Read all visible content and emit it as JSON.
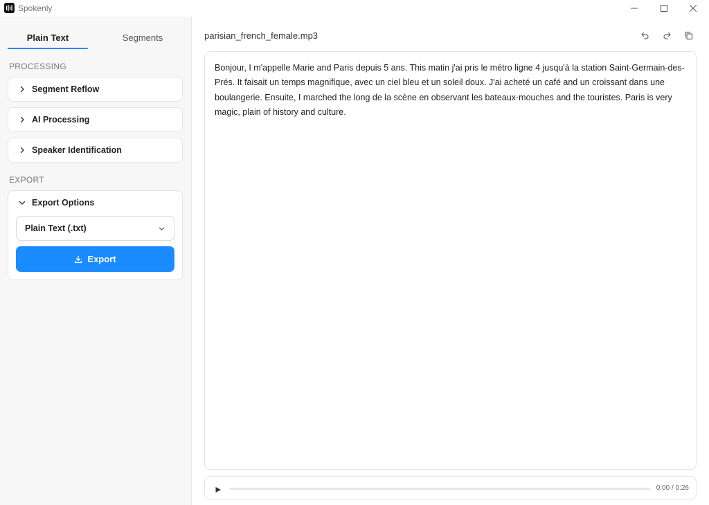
{
  "window": {
    "app_title": "Spokenly",
    "logo_icon": "waveform-icon",
    "controls": [
      "minimize-icon",
      "maximize-icon",
      "close-icon"
    ]
  },
  "sidebar": {
    "tabs": [
      {
        "label": "Plain Text",
        "active": true
      },
      {
        "label": "Segments",
        "active": false
      }
    ],
    "processing_label": "PROCESSING",
    "processing_items": [
      {
        "label": "Segment Reflow",
        "expanded": false
      },
      {
        "label": "AI Processing",
        "expanded": false
      },
      {
        "label": "Speaker Identification",
        "expanded": false
      }
    ],
    "export_label": "EXPORT",
    "export_panel": {
      "title": "Export Options",
      "expanded": true,
      "format_selected": "Plain Text (.txt)",
      "export_button": "Export"
    }
  },
  "main": {
    "file_name": "parisian_french_female.mp3",
    "toolbar_icons": [
      "undo-icon",
      "redo-icon",
      "copy-icon"
    ],
    "transcript": "Bonjour, I m'appelle Marie and Paris depuis 5 ans. This matin j'ai pris le métro ligne 4 jusqu'à la station Saint-Germain-des-Prés. It faisait un temps magnifique, avec un ciel bleu et un soleil doux. J'ai acheté un café and un croissant dans une boulangerie. Ensuite, I marched the long de la scène en observant les bateaux-mouches and the touristes. Paris is very magic, plain of history and culture.",
    "player": {
      "time": "0:00 / 0:26",
      "progress": 0
    }
  },
  "colors": {
    "accent": "#1a8cff",
    "sidebar_bg": "#f7f7f7",
    "border": "#e4e4e4"
  }
}
